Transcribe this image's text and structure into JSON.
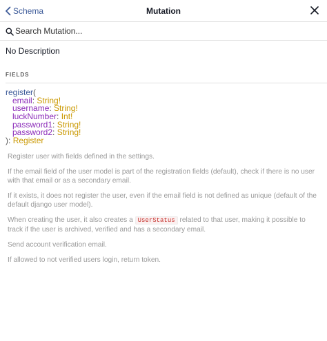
{
  "header": {
    "back_label": "Schema",
    "title": "Mutation"
  },
  "search": {
    "placeholder": "Search Mutation..."
  },
  "description": "No Description",
  "section_title": "FIELDS",
  "field": {
    "name": "register",
    "open_paren": "(",
    "args": [
      {
        "name": "email",
        "type": "String!"
      },
      {
        "name": "username",
        "type": "String!"
      },
      {
        "name": "luckNumber",
        "type": "Int!"
      },
      {
        "name": "password1",
        "type": "String!"
      },
      {
        "name": "password2",
        "type": "String!"
      }
    ],
    "close": "):",
    "return_type": "Register"
  },
  "field_description": {
    "p1": "Register user with fields defined in the settings.",
    "p2": "If the email field of the user model is part of the registration fields (default), check if there is no user with that email or as a secondary email.",
    "p3": "If it exists, it does not register the user, even if the email field is not defined as unique (default of the default django user model).",
    "p4_pre": "When creating the user, it also creates a ",
    "p4_code": "UserStatus",
    "p4_post": " related to that user, making it possible to track if the user is archived, verified and has a secondary email.",
    "p5": "Send account verification email.",
    "p6": "If allowed to not verified users login, return token."
  },
  "colors": {
    "link": "#3b5998",
    "arg": "#8b2bb9",
    "type": "#ca9800",
    "code": "#c4302b"
  },
  "icons": [
    "chevron-left-icon",
    "close-icon",
    "search-icon"
  ]
}
